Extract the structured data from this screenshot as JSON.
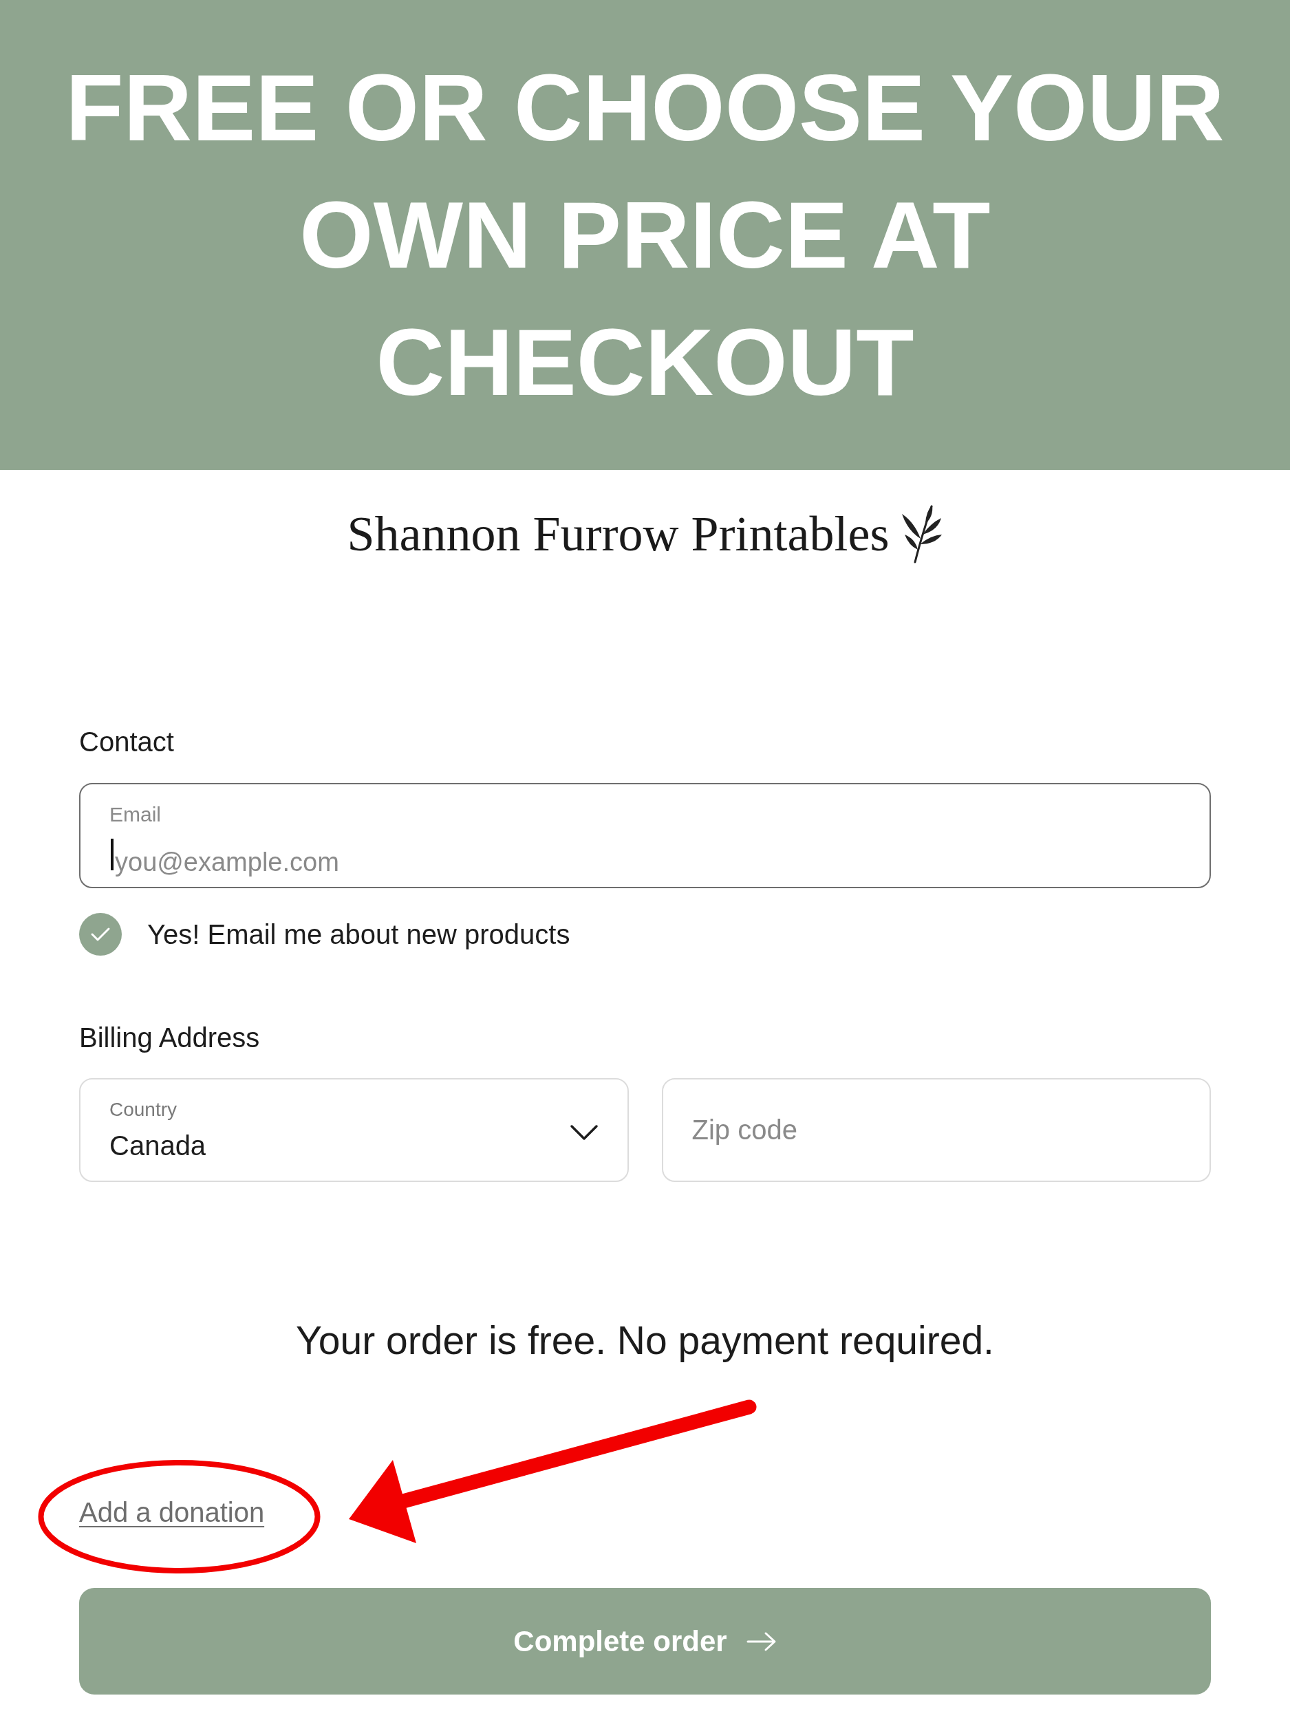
{
  "banner": {
    "headline": "FREE OR CHOOSE YOUR OWN PRICE AT CHECKOUT"
  },
  "header": {
    "store_name": "Shannon Furrow Printables"
  },
  "contact": {
    "heading": "Contact",
    "email": {
      "label": "Email",
      "placeholder": "you@example.com",
      "focused": true
    },
    "newsletter": {
      "label": "Yes! Email me about new products",
      "checked": true
    }
  },
  "billing": {
    "heading": "Billing Address",
    "country": {
      "label": "Country",
      "value": "Canada"
    },
    "zip": {
      "placeholder": "Zip code"
    }
  },
  "order_message": "Your order is free. No payment required.",
  "donation_link": "Add a donation",
  "submit_button": {
    "label": "Complete order"
  },
  "annotations": [
    {
      "kind": "ellipse"
    },
    {
      "kind": "arrow"
    }
  ]
}
